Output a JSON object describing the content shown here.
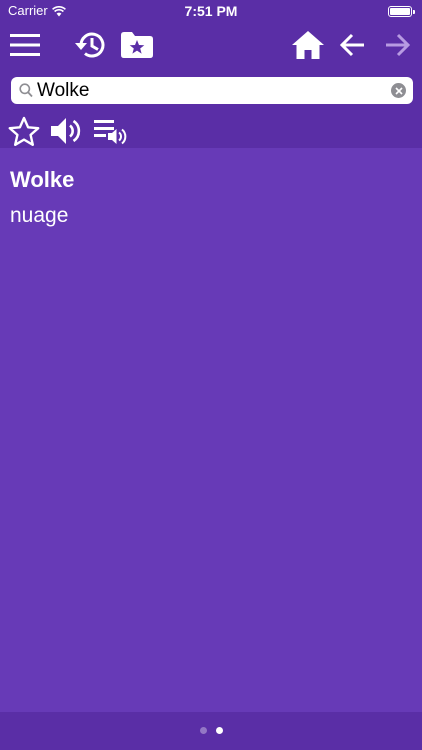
{
  "status_bar": {
    "carrier": "Carrier",
    "time": "7:51 PM"
  },
  "toolbar": {
    "icons": [
      "menu-icon",
      "history-icon",
      "favorites-folder-icon",
      "home-icon",
      "back-arrow-icon",
      "forward-arrow-icon"
    ]
  },
  "search": {
    "value": "Wolke",
    "placeholder": ""
  },
  "actions": {
    "icons": [
      "star-icon",
      "speaker-icon",
      "playlist-audio-icon"
    ]
  },
  "entry": {
    "headword": "Wolke",
    "translation": "nuage"
  },
  "pager": {
    "pages": 2,
    "current": 2
  },
  "colors": {
    "header": "#5a2ea6",
    "background": "#673ab7",
    "text": "#ffffff"
  }
}
